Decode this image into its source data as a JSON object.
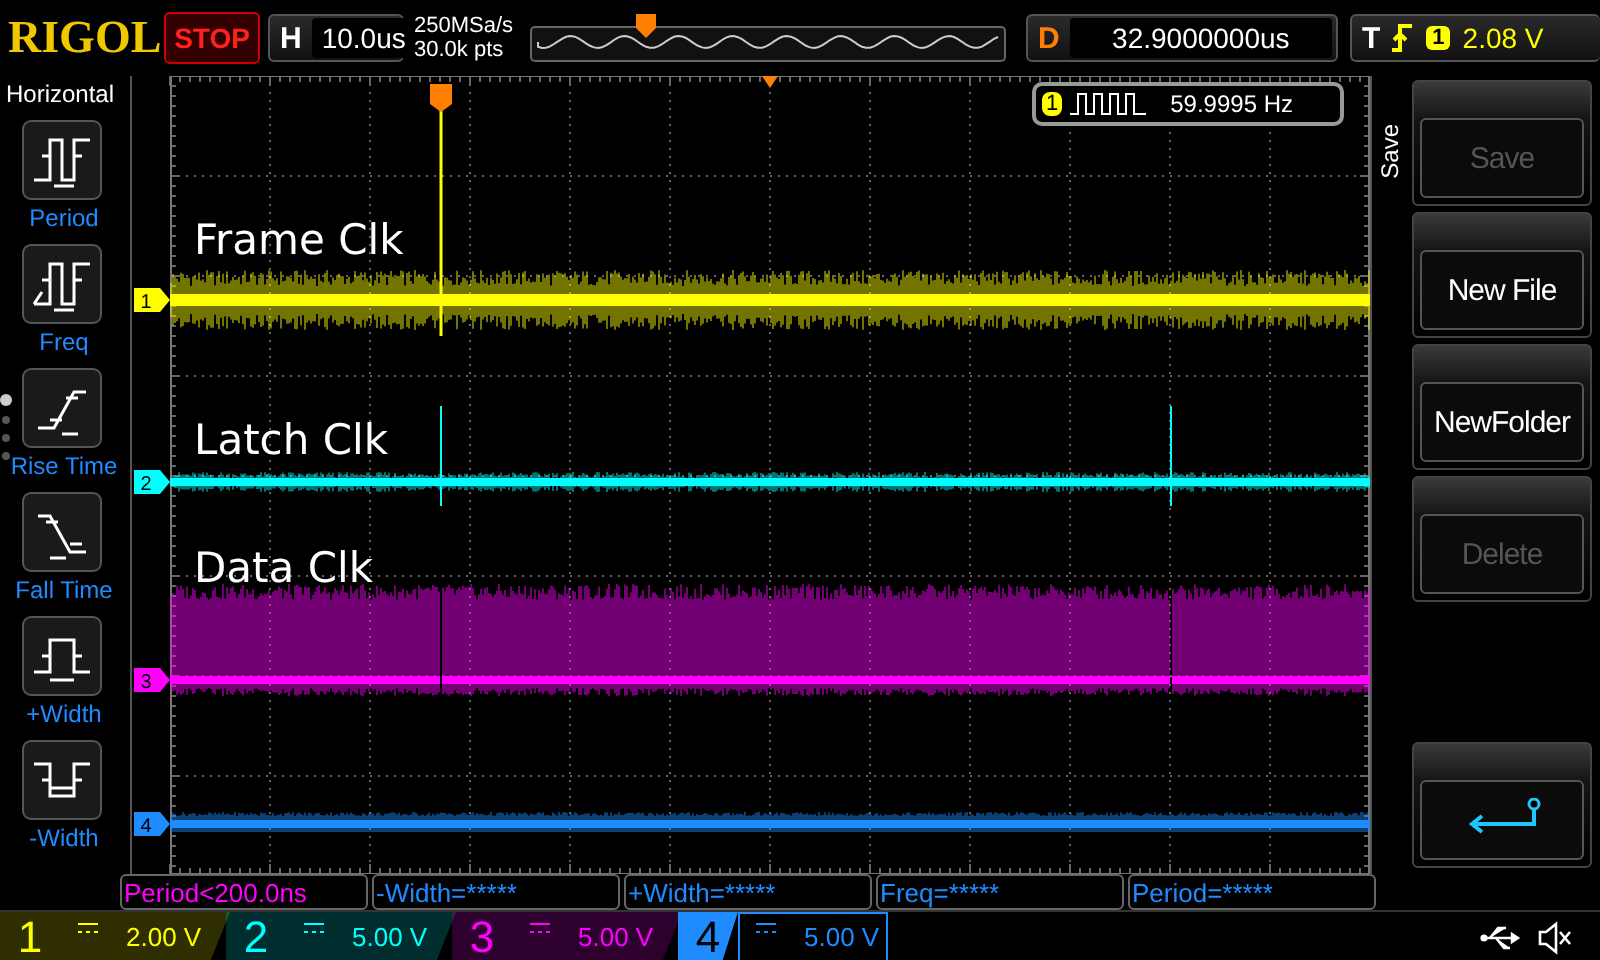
{
  "top_bar": {
    "logo": "RIGOL",
    "run_state": "STOP",
    "timebase": {
      "label": "H",
      "value": "10.0us"
    },
    "sample_rate": "250MSa/s",
    "memory_depth": "30.0k pts",
    "delay": {
      "label": "D",
      "value": "32.9000000us"
    },
    "trigger": {
      "label": "T",
      "channel": "1",
      "level": "2.08 V"
    }
  },
  "measure_menu": {
    "title": "Horizontal",
    "pages": [
      {
        "selected": true
      },
      {
        "selected": false
      },
      {
        "selected": false
      },
      {
        "selected": false
      }
    ],
    "items": [
      {
        "kind": "period",
        "label": "Period"
      },
      {
        "kind": "freq",
        "label": "Freq"
      },
      {
        "kind": "rise",
        "label": "Rise Time"
      },
      {
        "kind": "fall",
        "label": "Fall Time"
      },
      {
        "kind": "pwidth",
        "label": "+Width"
      },
      {
        "kind": "nwidth",
        "label": "-Width"
      }
    ]
  },
  "display": {
    "frequency_counter": {
      "channel": "1",
      "value": "59.9995 Hz"
    },
    "traces": [
      {
        "marker": "1",
        "label": "Frame Clk",
        "color": "#ffff00",
        "kind": "dense"
      },
      {
        "marker": "2",
        "label": "Latch Clk",
        "color": "#00ffff",
        "kind": "spikes"
      },
      {
        "marker": "3",
        "label": "Data Clk",
        "color": "#ff00ff",
        "kind": "burst"
      },
      {
        "marker": "4",
        "color": "#1e8cff",
        "kind": "flat"
      }
    ]
  },
  "softkeys": {
    "title": "Save",
    "items": [
      {
        "kind": "text",
        "label": "Save",
        "disabled": true
      },
      {
        "kind": "text",
        "label": "New File",
        "disabled": false
      },
      {
        "kind": "text",
        "label": "NewFolder",
        "disabled": false
      },
      {
        "kind": "text",
        "label": "Delete",
        "disabled": true
      },
      {
        "kind": "back"
      }
    ]
  },
  "measurements": [
    {
      "text": "Period<200.0ns",
      "kind": "active"
    },
    {
      "text": "-Width=*****",
      "kind": "inactive"
    },
    {
      "text": "+Width=*****",
      "kind": "inactive"
    },
    {
      "text": "Freq=*****",
      "kind": "inactive"
    },
    {
      "text": "Period=*****",
      "kind": "inactive"
    }
  ],
  "channel_bar": [
    {
      "number": "1",
      "scale": "2.00 V",
      "color": "#ffff00",
      "selected": false
    },
    {
      "number": "2",
      "scale": "5.00 V",
      "color": "#00ffff",
      "selected": false
    },
    {
      "number": "3",
      "scale": "5.00 V",
      "color": "#ff00ff",
      "selected": false
    },
    {
      "number": "4",
      "scale": "5.00 V",
      "color": "#1e8cff",
      "selected": true
    }
  ]
}
